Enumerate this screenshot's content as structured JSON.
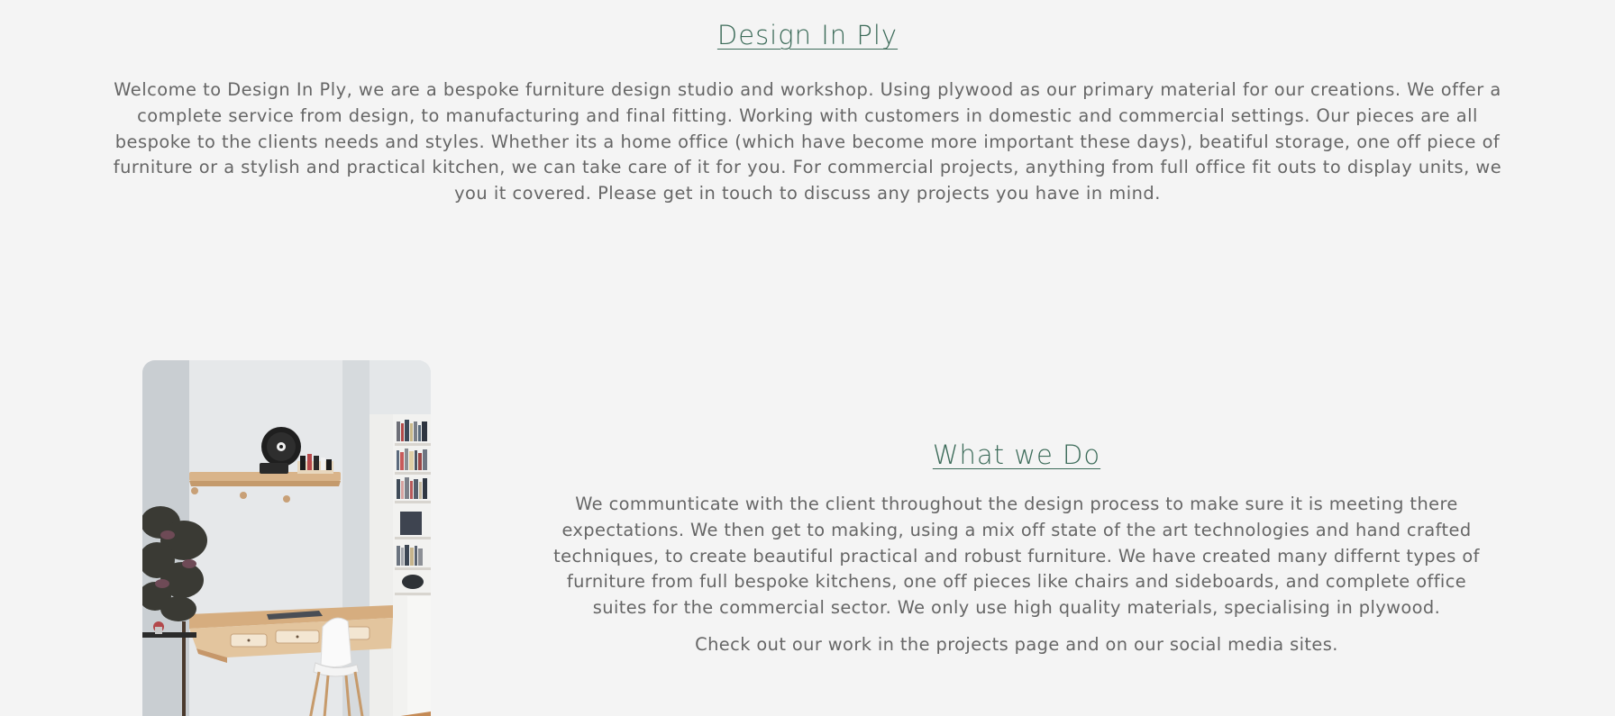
{
  "intro": {
    "title": "Design In Ply",
    "body": "Welcome to Design In Ply, we are a bespoke furniture design studio and workshop. Using plywood as our primary material for our creations. We offer a complete service from design, to manufacturing and final fitting. Working with customers in domestic and commercial settings. Our pieces are all bespoke to the clients needs and styles. Whether its a home office (which have become more important these days), beatiful storage, one off piece of furniture or a stylish and practical kitchen, we can take care of it for you. For commercial projects, anything from full office fit outs to display units, we you it covered. Please get in touch to discuss any projects you have in mind."
  },
  "what_we_do": {
    "title": "What we Do",
    "body": "We communticate with the client throughout the design process to make sure it is meeting there expectations. We then get to making, using a mix off state of the art technologies and hand crafted techniques, to create beautiful practical and robust furniture. We have created many differnt types of furniture from full bespoke kitchens, one off pieces like chairs and sideboards, and complete office suites for the commercial sector. We only use high quality materials, specialising in plywood.",
    "cta": "Check out our work in the projects page and on our social media sites."
  },
  "colors": {
    "background": "#f4f4f4",
    "heading": "#3c6b59",
    "body_text": "#666666"
  },
  "photo": {
    "subject": "plywood-desk-alcove-photo"
  }
}
